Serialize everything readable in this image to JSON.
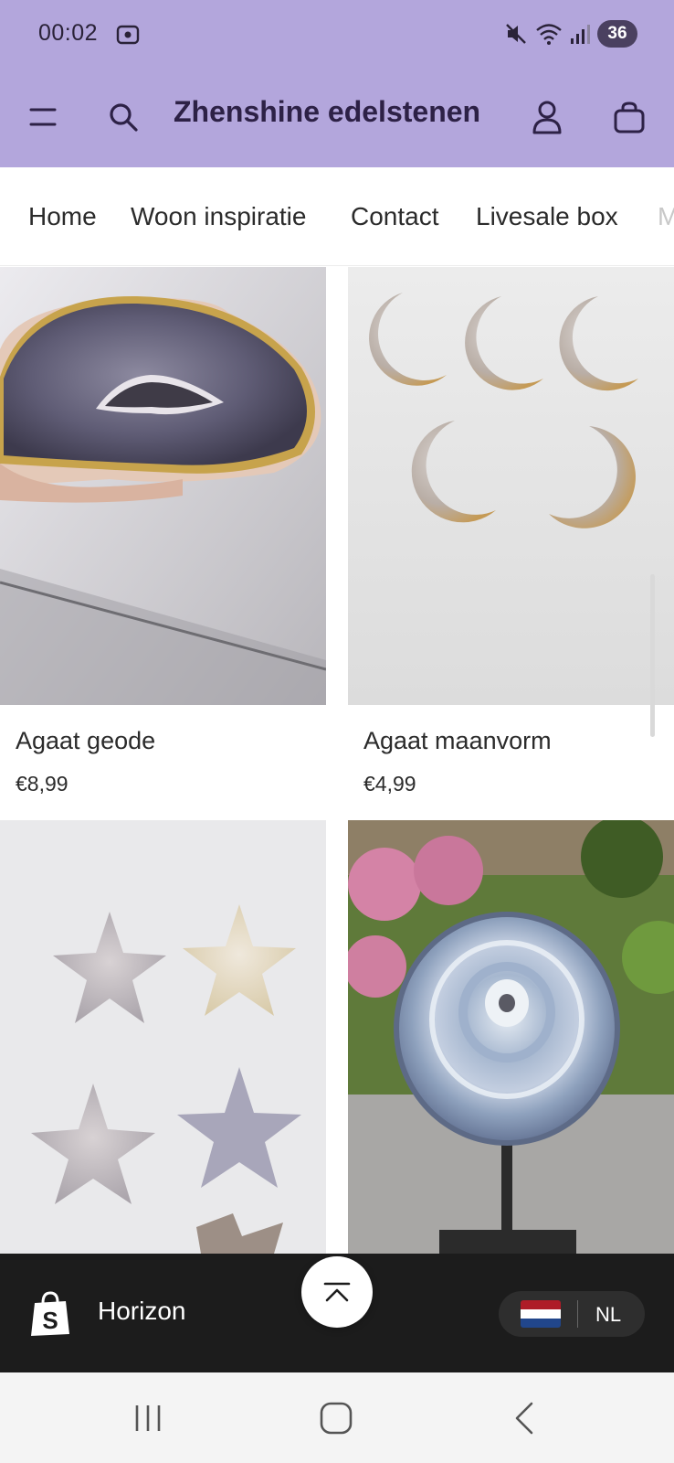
{
  "status_bar": {
    "time": "00:02",
    "battery": "36",
    "icons": [
      "screen-record-icon",
      "mute-icon",
      "wifi-icon",
      "signal-icon",
      "battery-icon"
    ]
  },
  "header": {
    "title": "Zhenshine edelstenen",
    "background": "#b3a6dc",
    "icons": [
      "menu-icon",
      "search-icon",
      "account-icon",
      "cart-icon"
    ]
  },
  "nav": {
    "items": [
      "Home",
      "Woon inspiratie",
      "Contact",
      "Livesale box"
    ],
    "overflow_label": "M"
  },
  "products": [
    {
      "name": "Agaat geode",
      "price": "€8,99"
    },
    {
      "name": "Agaat maanvorm",
      "price": "€4,99"
    },
    {
      "name": "",
      "price": ""
    },
    {
      "name": "",
      "price": ""
    }
  ],
  "shop_bar": {
    "theme_name": "Horizon",
    "language": "NL",
    "flag_colors": [
      "#ae1c28",
      "#ffffff",
      "#21468b"
    ]
  },
  "back_to_top": {
    "icon": "chevron-up-icon"
  },
  "system_nav": {
    "icons": [
      "recent-apps-icon",
      "home-icon",
      "back-icon"
    ]
  }
}
